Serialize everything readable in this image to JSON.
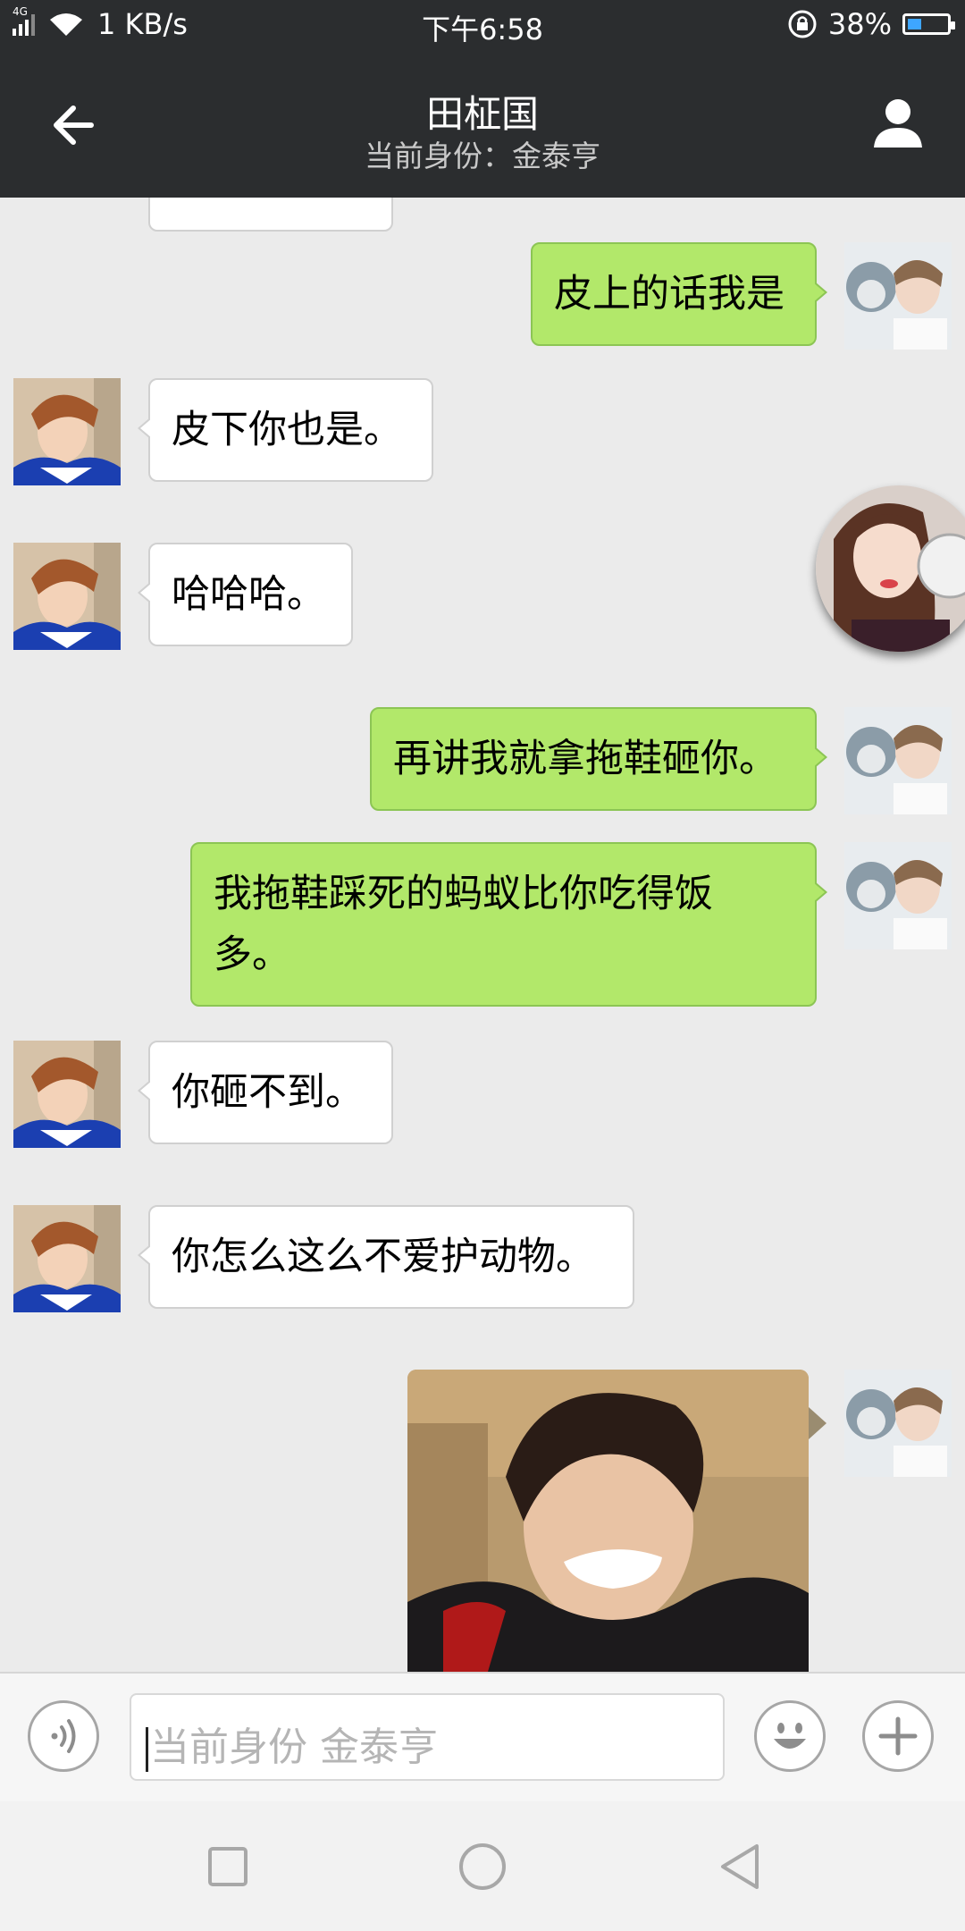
{
  "status_bar": {
    "network": "4G",
    "speed": "1 KB/s",
    "time": "下午6:58",
    "battery": "38%",
    "battery_level": 0.38
  },
  "header": {
    "title": "田柾国",
    "subtitle": "当前身份：金泰亨"
  },
  "messages": [
    {
      "side": "right",
      "text": "皮上的话我是"
    },
    {
      "side": "left",
      "text": "皮下你也是。"
    },
    {
      "side": "left",
      "text": "哈哈哈。"
    },
    {
      "side": "right",
      "text": "再讲我就拿拖鞋砸你。"
    },
    {
      "side": "right",
      "line1": "我拖鞋踩死的蚂蚁比你吃得饭",
      "line2": "多。"
    },
    {
      "side": "left",
      "text": "你砸不到。"
    },
    {
      "side": "left",
      "text": "你怎么这么不爱护动物。"
    },
    {
      "side": "right",
      "type": "image"
    }
  ],
  "input": {
    "placeholder": "当前身份 金泰亨"
  },
  "colors": {
    "header_bg": "#2b2d2f",
    "chat_bg": "#ebebeb",
    "sent_bubble": "#b2e86a",
    "received_bubble": "#ffffff"
  }
}
